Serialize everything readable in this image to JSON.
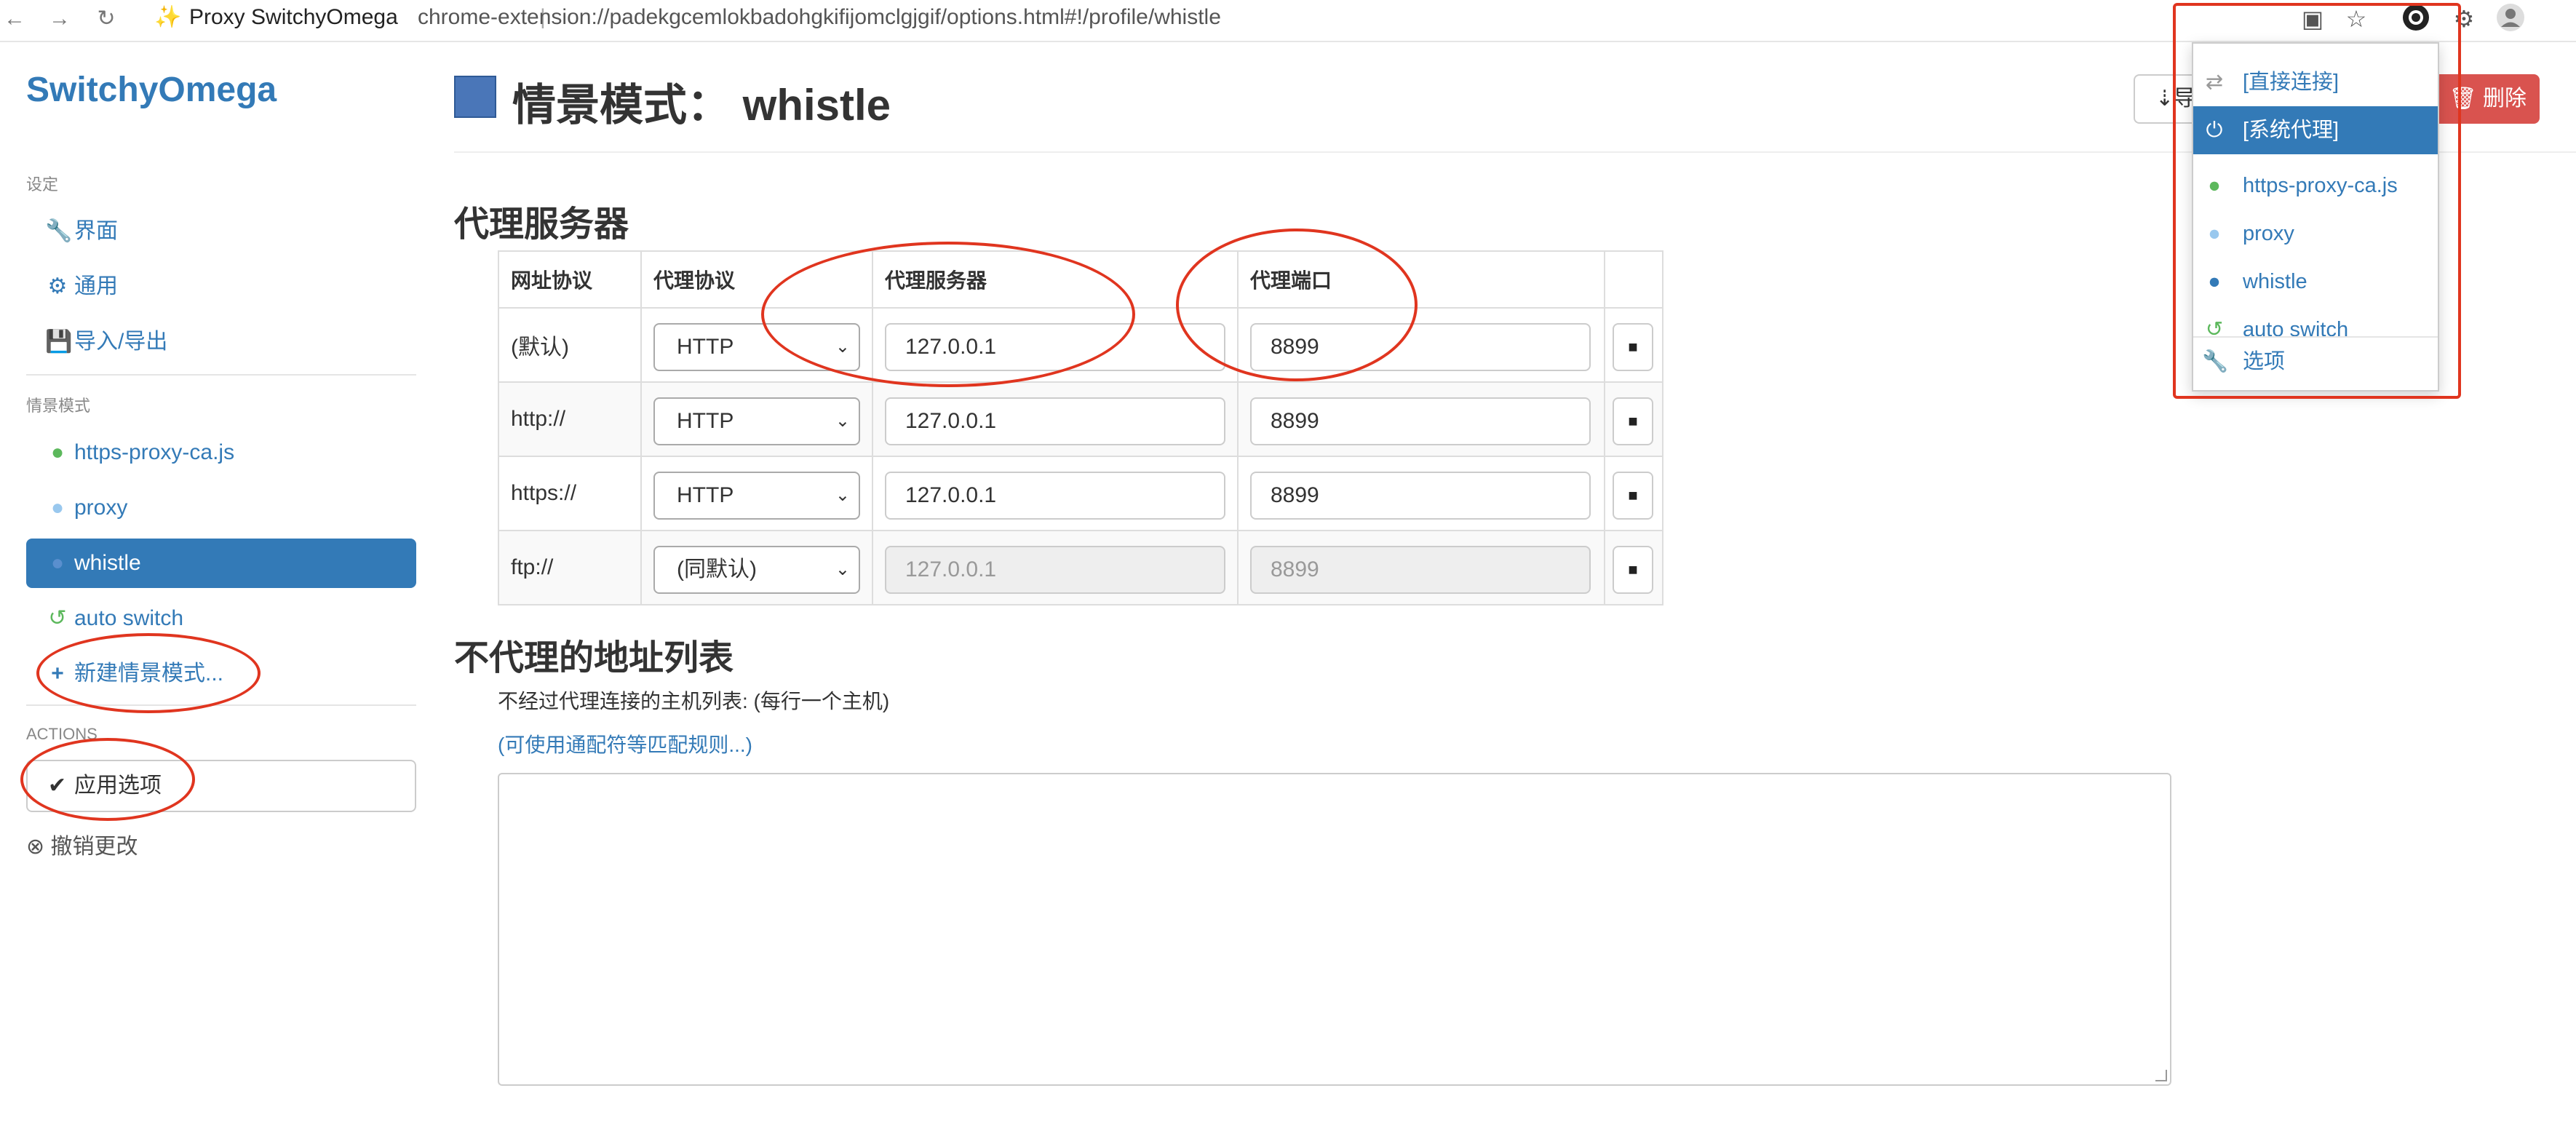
{
  "browser": {
    "back_icon": "arrow-left-icon",
    "forward_icon": "arrow-right-icon",
    "reload_icon": "reload-icon",
    "site_name": "Proxy SwitchyOmega",
    "url": "chrome-extension://padekgcemlokbadohgkifijomclgjgif/options.html#!/profile/whistle"
  },
  "sidebar": {
    "brand": "SwitchyOmega",
    "settings_header": "设定",
    "settings_items": [
      {
        "label": "界面",
        "icon": "wrench-icon"
      },
      {
        "label": "通用",
        "icon": "gear-icon"
      },
      {
        "label": "导入/导出",
        "icon": "floppy-icon"
      }
    ],
    "profiles_header": "情景模式",
    "profile_items": [
      {
        "label": "https-proxy-ca.js",
        "icon": "globe-icon",
        "color": "#5cb85c"
      },
      {
        "label": "proxy",
        "icon": "globe-icon",
        "color": "#99c8ee"
      },
      {
        "label": "whistle",
        "icon": "globe-icon",
        "color": "#ffffff"
      },
      {
        "label": "auto switch",
        "icon": "switch-icon",
        "color": "#5cb85c"
      }
    ],
    "new_profile": "新建情景模式...",
    "actions_header": "ACTIONS",
    "apply_button": "应用选项",
    "discard_link": "撤销更改"
  },
  "main": {
    "title": "情景模式：  whistle",
    "swatch_color": "#4a76b8",
    "export_button": "导",
    "delete_button": "删除",
    "proxy_section_title": "代理服务器",
    "table": {
      "headers": [
        "网址协议",
        "代理协议",
        "代理服务器",
        "代理端口"
      ],
      "rows": [
        {
          "scheme": "(默认)",
          "protocol": "HTTP",
          "server": "127.0.0.1",
          "port": "8899",
          "disabled": false
        },
        {
          "scheme": "http://",
          "protocol": "HTTP",
          "server": "127.0.0.1",
          "port": "8899",
          "disabled": false
        },
        {
          "scheme": "https://",
          "protocol": "HTTP",
          "server": "127.0.0.1",
          "port": "8899",
          "disabled": false
        },
        {
          "scheme": "ftp://",
          "protocol": "(同默认)",
          "server": "127.0.0.1",
          "port": "8899",
          "disabled": true
        }
      ]
    },
    "bypass_section_title": "不代理的地址列表",
    "bypass_label": "不经过代理连接的主机列表: (每行一个主机)",
    "bypass_link": "(可使用通配符等匹配规则...)",
    "bypass_value": ""
  },
  "popup": {
    "items": [
      {
        "label": "[直接连接]",
        "icon": "transfer-icon",
        "color": "#999999",
        "active": false
      },
      {
        "label": "[系统代理]",
        "icon": "power-icon",
        "color": "#ffffff",
        "active": true
      },
      {
        "label": "https-proxy-ca.js",
        "icon": "globe-icon",
        "color": "#5cb85c",
        "active": false
      },
      {
        "label": "proxy",
        "icon": "globe-icon",
        "color": "#99c8ee",
        "active": false
      },
      {
        "label": "whistle",
        "icon": "globe-icon",
        "color": "#337ab7",
        "active": false
      },
      {
        "label": "auto switch",
        "icon": "switch-icon",
        "color": "#5cb85c",
        "active": false
      }
    ],
    "options_label": "选项"
  },
  "annotation_color": "#e0351f"
}
